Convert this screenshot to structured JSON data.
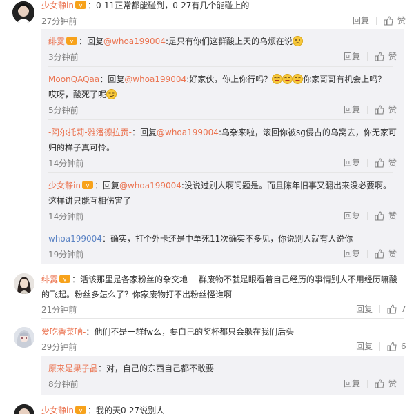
{
  "labels": {
    "reply": "回复",
    "like": "赞"
  },
  "comments": [
    {
      "user": "少女静in",
      "text": "：0-11正常都能碰到，0-27有几个能碰上的",
      "time": "27分钟前",
      "likes": "赞",
      "replies": [
        {
          "user": "绯霙",
          "prefix": "：回复",
          "at": "@whoa199004",
          "text": ":是只有你们这群酸上天的乌烦在说",
          "time": "3分钟前"
        },
        {
          "user": "MoonQAQaa",
          "prefix": "：回复",
          "at": "@whoa199004",
          "text": ":好家伙，你上你行吗？",
          "text2": "你家哥哥有机会上吗？",
          "text3": "哎呀，酸死了呢",
          "time": "5分钟前"
        },
        {
          "user": "-阿尔托莉-雅潘德拉贡-",
          "prefix": "：回复",
          "at": "@whoa199004",
          "text": ":乌杂来啦，滚回你被sg侵占的乌窝去，你无家可",
          "text2": "归的样子真可怜。",
          "time": "14分钟前"
        },
        {
          "user": "少女静in",
          "prefix": "：回复",
          "at": "@whoa199004",
          "text": ":没说过别人啊问题是。而且陈年旧事又翻出来没必要啊。",
          "text2": "这样讲只能互相伤害了",
          "time": "14分钟前"
        },
        {
          "user": "whoa199004",
          "text": "：确实，打个外卡还是中单死11次确实不多见，你说别人就有人说你",
          "time": "19分钟前"
        }
      ]
    },
    {
      "user": "绯霙",
      "text": "：活该那里是各家粉丝的杂交地 一群废物不就是眼看着自己经历的事情别人不用经历嘛酸",
      "text2": "的飞起。粉丝多怎么了？你家废物打不出粉丝怪谁啊",
      "time": "21分钟前",
      "likes": "7"
    },
    {
      "user": "爱吃香菜呐-",
      "text": "：他们不是一群fw么，要自己的奖杯都只会躲在我们后头",
      "time": "29分钟前",
      "likes": "6",
      "replies": [
        {
          "user": "原来是果子晶",
          "text": "：对，自己的东西自己都不敢要",
          "time": "8分钟前"
        }
      ]
    },
    {
      "user": "少女静in",
      "text": "：我的天0-27说别人"
    }
  ],
  "colors": {
    "username": "#eb7350",
    "mention": "#eb7350",
    "meta": "#808080",
    "panel": "#f2f2f5"
  }
}
